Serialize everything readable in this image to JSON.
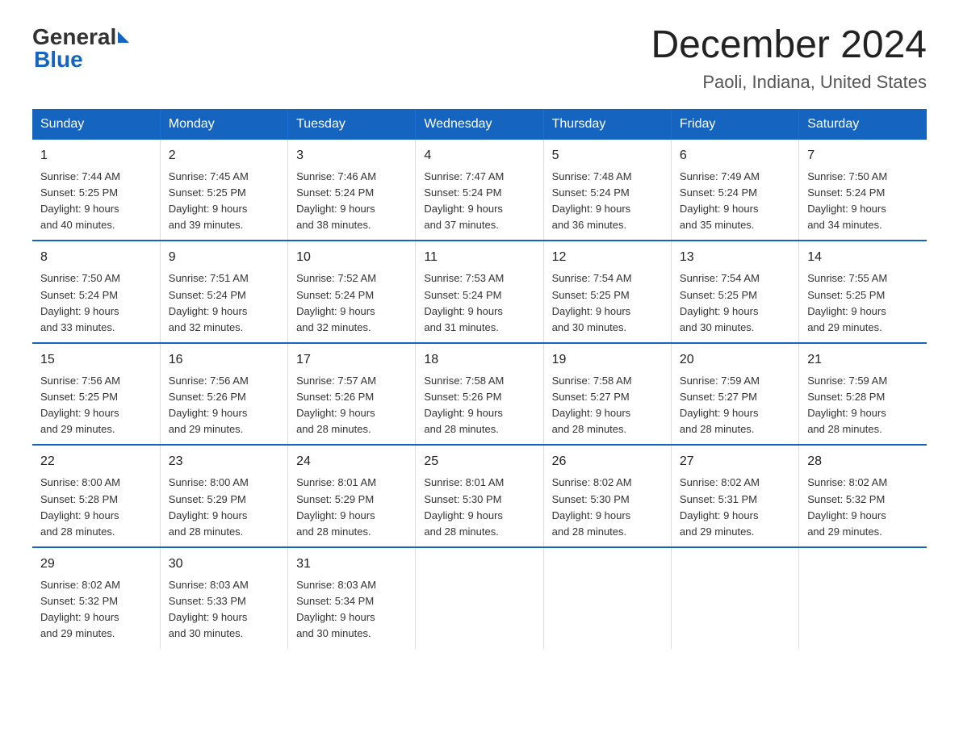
{
  "logo": {
    "general": "General",
    "blue": "Blue"
  },
  "title": "December 2024",
  "location": "Paoli, Indiana, United States",
  "days_of_week": [
    "Sunday",
    "Monday",
    "Tuesday",
    "Wednesday",
    "Thursday",
    "Friday",
    "Saturday"
  ],
  "weeks": [
    [
      {
        "num": "1",
        "sunrise": "7:44 AM",
        "sunset": "5:25 PM",
        "daylight": "9 hours and 40 minutes."
      },
      {
        "num": "2",
        "sunrise": "7:45 AM",
        "sunset": "5:25 PM",
        "daylight": "9 hours and 39 minutes."
      },
      {
        "num": "3",
        "sunrise": "7:46 AM",
        "sunset": "5:24 PM",
        "daylight": "9 hours and 38 minutes."
      },
      {
        "num": "4",
        "sunrise": "7:47 AM",
        "sunset": "5:24 PM",
        "daylight": "9 hours and 37 minutes."
      },
      {
        "num": "5",
        "sunrise": "7:48 AM",
        "sunset": "5:24 PM",
        "daylight": "9 hours and 36 minutes."
      },
      {
        "num": "6",
        "sunrise": "7:49 AM",
        "sunset": "5:24 PM",
        "daylight": "9 hours and 35 minutes."
      },
      {
        "num": "7",
        "sunrise": "7:50 AM",
        "sunset": "5:24 PM",
        "daylight": "9 hours and 34 minutes."
      }
    ],
    [
      {
        "num": "8",
        "sunrise": "7:50 AM",
        "sunset": "5:24 PM",
        "daylight": "9 hours and 33 minutes."
      },
      {
        "num": "9",
        "sunrise": "7:51 AM",
        "sunset": "5:24 PM",
        "daylight": "9 hours and 32 minutes."
      },
      {
        "num": "10",
        "sunrise": "7:52 AM",
        "sunset": "5:24 PM",
        "daylight": "9 hours and 32 minutes."
      },
      {
        "num": "11",
        "sunrise": "7:53 AM",
        "sunset": "5:24 PM",
        "daylight": "9 hours and 31 minutes."
      },
      {
        "num": "12",
        "sunrise": "7:54 AM",
        "sunset": "5:25 PM",
        "daylight": "9 hours and 30 minutes."
      },
      {
        "num": "13",
        "sunrise": "7:54 AM",
        "sunset": "5:25 PM",
        "daylight": "9 hours and 30 minutes."
      },
      {
        "num": "14",
        "sunrise": "7:55 AM",
        "sunset": "5:25 PM",
        "daylight": "9 hours and 29 minutes."
      }
    ],
    [
      {
        "num": "15",
        "sunrise": "7:56 AM",
        "sunset": "5:25 PM",
        "daylight": "9 hours and 29 minutes."
      },
      {
        "num": "16",
        "sunrise": "7:56 AM",
        "sunset": "5:26 PM",
        "daylight": "9 hours and 29 minutes."
      },
      {
        "num": "17",
        "sunrise": "7:57 AM",
        "sunset": "5:26 PM",
        "daylight": "9 hours and 28 minutes."
      },
      {
        "num": "18",
        "sunrise": "7:58 AM",
        "sunset": "5:26 PM",
        "daylight": "9 hours and 28 minutes."
      },
      {
        "num": "19",
        "sunrise": "7:58 AM",
        "sunset": "5:27 PM",
        "daylight": "9 hours and 28 minutes."
      },
      {
        "num": "20",
        "sunrise": "7:59 AM",
        "sunset": "5:27 PM",
        "daylight": "9 hours and 28 minutes."
      },
      {
        "num": "21",
        "sunrise": "7:59 AM",
        "sunset": "5:28 PM",
        "daylight": "9 hours and 28 minutes."
      }
    ],
    [
      {
        "num": "22",
        "sunrise": "8:00 AM",
        "sunset": "5:28 PM",
        "daylight": "9 hours and 28 minutes."
      },
      {
        "num": "23",
        "sunrise": "8:00 AM",
        "sunset": "5:29 PM",
        "daylight": "9 hours and 28 minutes."
      },
      {
        "num": "24",
        "sunrise": "8:01 AM",
        "sunset": "5:29 PM",
        "daylight": "9 hours and 28 minutes."
      },
      {
        "num": "25",
        "sunrise": "8:01 AM",
        "sunset": "5:30 PM",
        "daylight": "9 hours and 28 minutes."
      },
      {
        "num": "26",
        "sunrise": "8:02 AM",
        "sunset": "5:30 PM",
        "daylight": "9 hours and 28 minutes."
      },
      {
        "num": "27",
        "sunrise": "8:02 AM",
        "sunset": "5:31 PM",
        "daylight": "9 hours and 29 minutes."
      },
      {
        "num": "28",
        "sunrise": "8:02 AM",
        "sunset": "5:32 PM",
        "daylight": "9 hours and 29 minutes."
      }
    ],
    [
      {
        "num": "29",
        "sunrise": "8:02 AM",
        "sunset": "5:32 PM",
        "daylight": "9 hours and 29 minutes."
      },
      {
        "num": "30",
        "sunrise": "8:03 AM",
        "sunset": "5:33 PM",
        "daylight": "9 hours and 30 minutes."
      },
      {
        "num": "31",
        "sunrise": "8:03 AM",
        "sunset": "5:34 PM",
        "daylight": "9 hours and 30 minutes."
      },
      null,
      null,
      null,
      null
    ]
  ],
  "labels": {
    "sunrise": "Sunrise:",
    "sunset": "Sunset:",
    "daylight": "Daylight:"
  }
}
